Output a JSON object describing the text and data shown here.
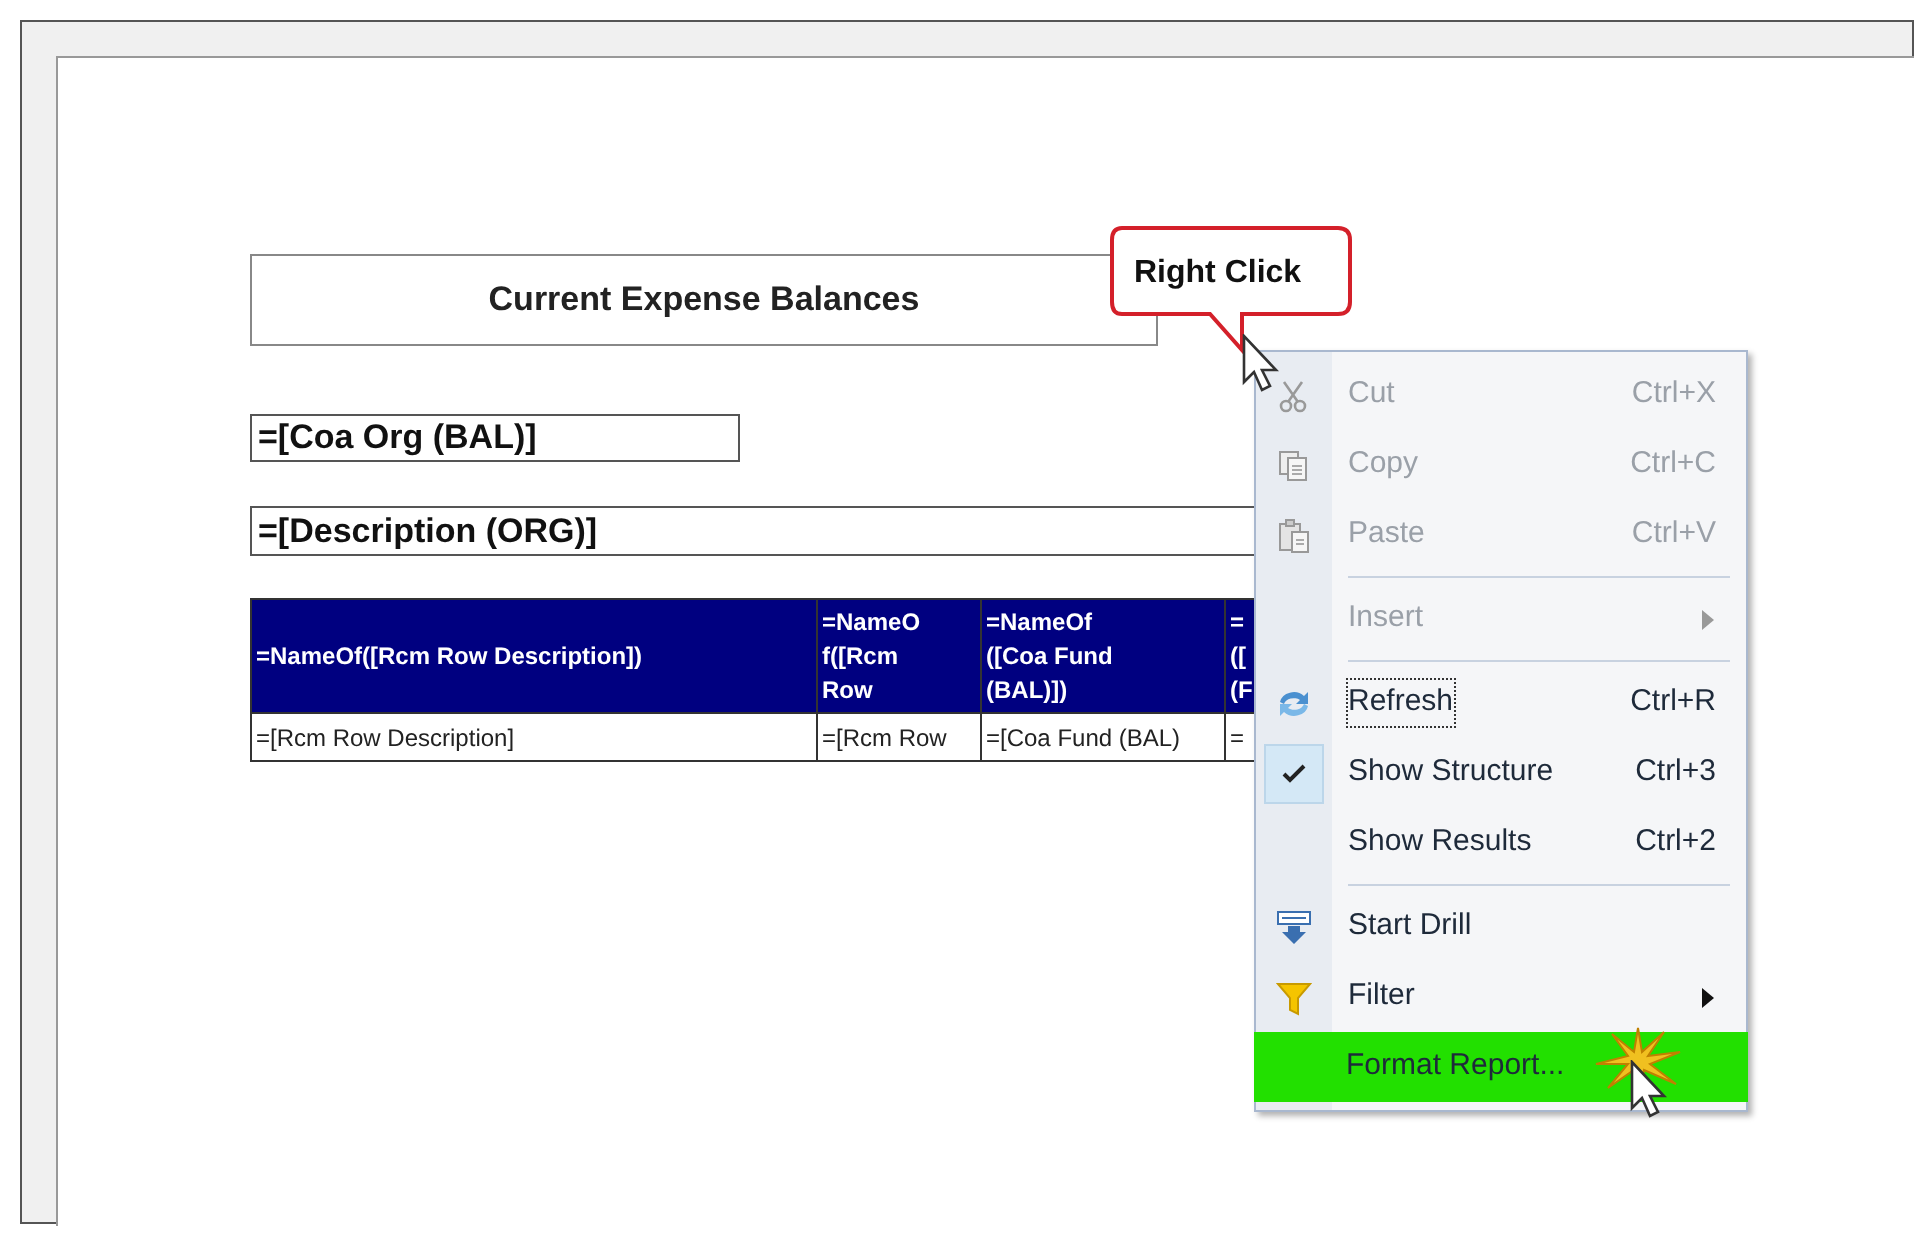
{
  "report": {
    "title": "Current Expense Balances",
    "fields": [
      "=[Coa Org (BAL)]",
      "=[Description (ORG)]"
    ],
    "table": {
      "columns": [
        {
          "lines": [
            "=NameOf([Rcm Row Description])"
          ]
        },
        {
          "lines": [
            "=NameO",
            "f([Rcm",
            "Row"
          ]
        },
        {
          "lines": [
            "=NameOf",
            "([Coa Fund",
            "(BAL)])"
          ]
        },
        {
          "lines": [
            "=",
            "([",
            "(F"
          ]
        }
      ],
      "rows": [
        [
          "=[Rcm Row Description]",
          "=[Rcm Row",
          "=[Coa Fund (BAL)",
          "="
        ]
      ]
    }
  },
  "callout": {
    "text": "Right Click"
  },
  "context_menu": {
    "items": [
      {
        "kind": "item",
        "label": "Cut",
        "shortcut": "Ctrl+X",
        "disabled": true,
        "checked": false,
        "focused": false,
        "submenu": false,
        "highlighted": false
      },
      {
        "kind": "item",
        "label": "Copy",
        "shortcut": "Ctrl+C",
        "disabled": true,
        "checked": false,
        "focused": false,
        "submenu": false,
        "highlighted": false
      },
      {
        "kind": "item",
        "label": "Paste",
        "shortcut": "Ctrl+V",
        "disabled": true,
        "checked": false,
        "focused": false,
        "submenu": false,
        "highlighted": false
      },
      {
        "kind": "separator"
      },
      {
        "kind": "item",
        "label": "Insert",
        "disabled": true,
        "checked": false,
        "focused": false,
        "submenu": true,
        "highlighted": false
      },
      {
        "kind": "separator"
      },
      {
        "kind": "item",
        "label": "Refresh",
        "shortcut": "Ctrl+R",
        "disabled": false,
        "checked": false,
        "focused": true,
        "submenu": false,
        "highlighted": false
      },
      {
        "kind": "item",
        "label": "Show Structure",
        "shortcut": "Ctrl+3",
        "disabled": false,
        "checked": true,
        "focused": false,
        "submenu": false,
        "highlighted": false
      },
      {
        "kind": "item",
        "label": "Show Results",
        "shortcut": "Ctrl+2",
        "disabled": false,
        "checked": false,
        "focused": false,
        "submenu": false,
        "highlighted": false
      },
      {
        "kind": "separator"
      },
      {
        "kind": "item",
        "label": "Start Drill",
        "disabled": false,
        "checked": false,
        "focused": false,
        "submenu": false,
        "highlighted": false
      },
      {
        "kind": "item",
        "label": "Filter",
        "disabled": false,
        "checked": false,
        "focused": false,
        "submenu": true,
        "highlighted": false
      },
      {
        "kind": "item",
        "label": "Format Report...",
        "disabled": false,
        "checked": false,
        "focused": false,
        "submenu": false,
        "highlighted": true
      }
    ]
  }
}
